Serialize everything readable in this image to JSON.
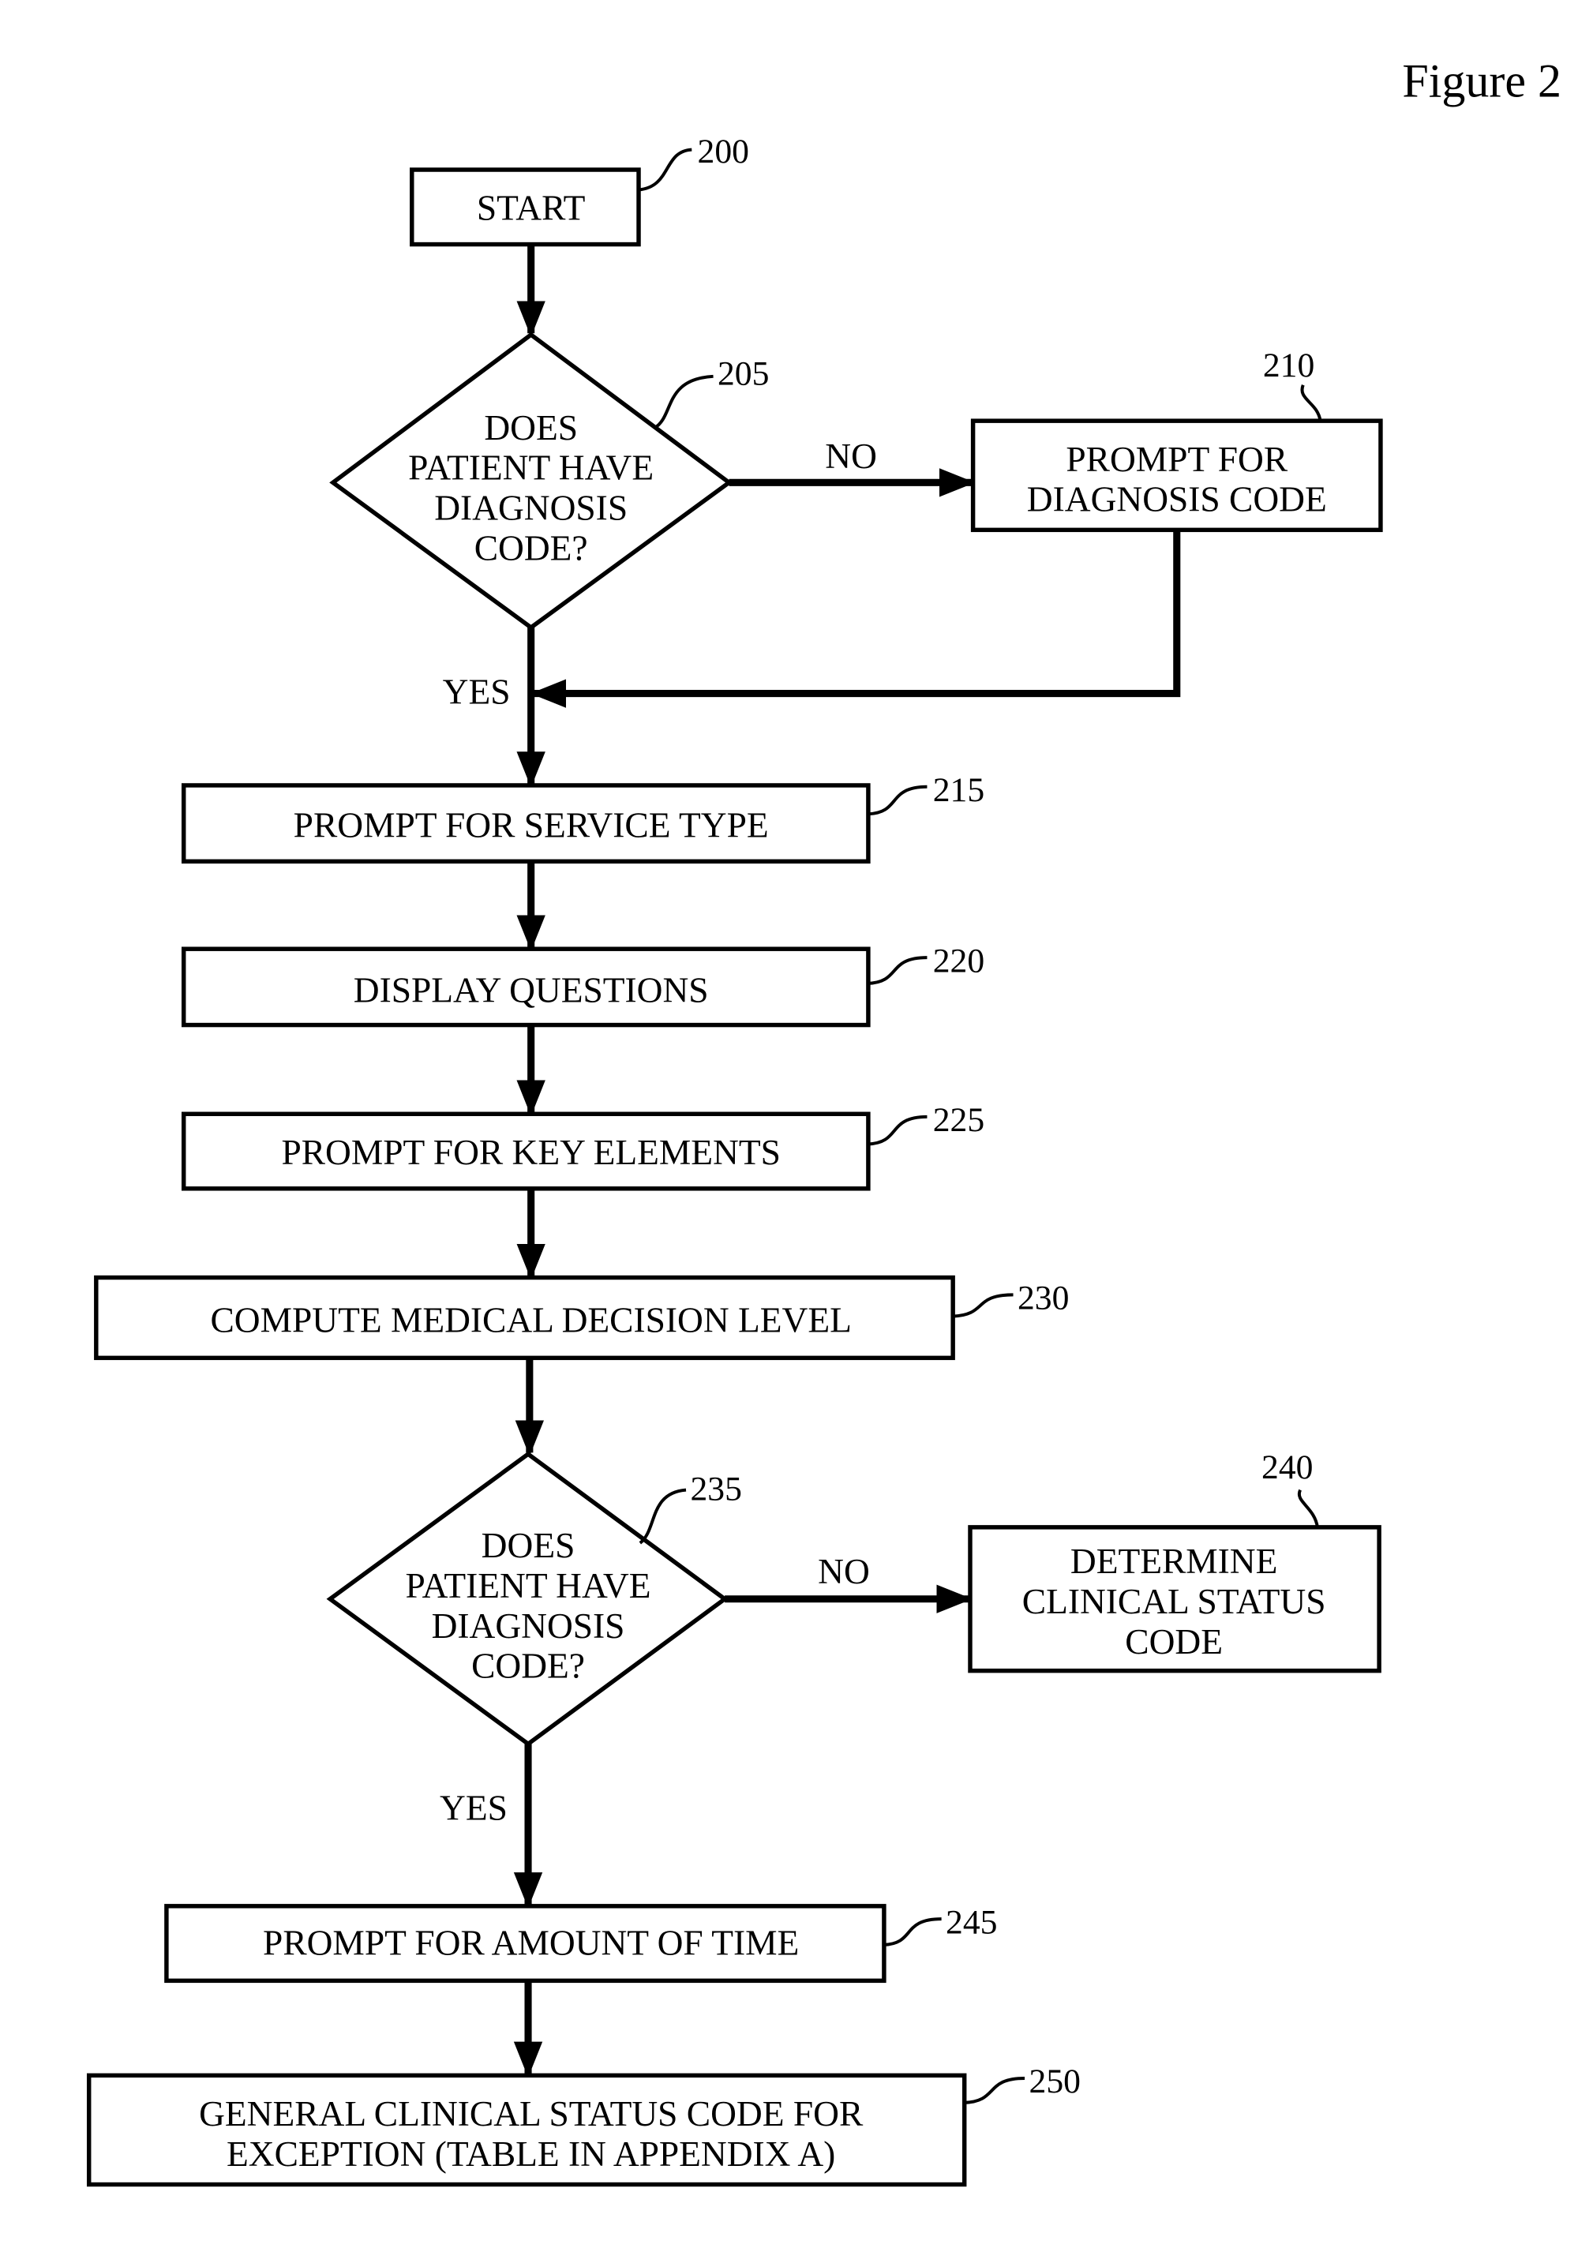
{
  "figure": {
    "title": "Figure 2"
  },
  "nodes": {
    "n200": {
      "ref": "200",
      "lines": [
        "START"
      ]
    },
    "n205": {
      "ref": "205",
      "lines": [
        "DOES",
        "PATIENT HAVE",
        "DIAGNOSIS",
        "CODE?"
      ]
    },
    "n210": {
      "ref": "210",
      "lines": [
        "PROMPT FOR",
        "DIAGNOSIS CODE"
      ]
    },
    "n215": {
      "ref": "215",
      "lines": [
        "PROMPT FOR SERVICE TYPE"
      ]
    },
    "n220": {
      "ref": "220",
      "lines": [
        "DISPLAY QUESTIONS"
      ]
    },
    "n225": {
      "ref": "225",
      "lines": [
        "PROMPT FOR KEY ELEMENTS"
      ]
    },
    "n230": {
      "ref": "230",
      "lines": [
        "COMPUTE MEDICAL DECISION LEVEL"
      ]
    },
    "n235": {
      "ref": "235",
      "lines": [
        "DOES",
        "PATIENT HAVE",
        "DIAGNOSIS",
        "CODE?"
      ]
    },
    "n240": {
      "ref": "240",
      "lines": [
        "DETERMINE",
        "CLINICAL STATUS",
        "CODE"
      ]
    },
    "n245": {
      "ref": "245",
      "lines": [
        "PROMPT FOR AMOUNT OF TIME"
      ]
    },
    "n250": {
      "ref": "250",
      "lines": [
        "GENERAL CLINICAL STATUS CODE FOR",
        "EXCEPTION (TABLE IN APPENDIX A)"
      ]
    }
  },
  "edges": {
    "e205_no": "NO",
    "e205_yes": "YES",
    "e235_no": "NO",
    "e235_yes": "YES"
  }
}
